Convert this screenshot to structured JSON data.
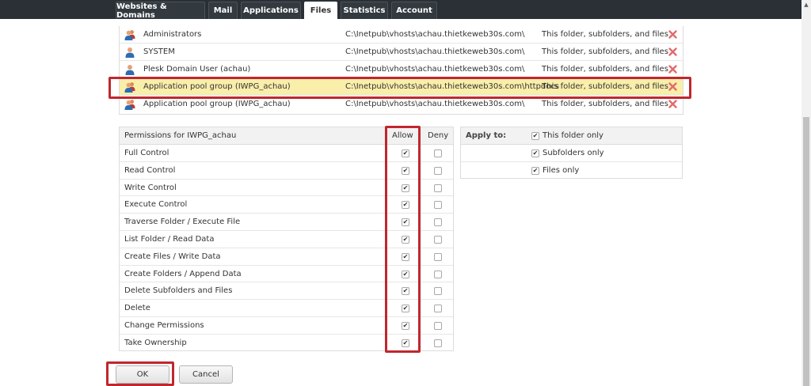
{
  "nav": {
    "tabs": [
      {
        "label": "Websites & Domains",
        "active": false
      },
      {
        "label": "Mail",
        "active": false
      },
      {
        "label": "Applications",
        "active": false
      },
      {
        "label": "Files",
        "active": true
      },
      {
        "label": "Statistics",
        "active": false
      },
      {
        "label": "Account",
        "active": false
      }
    ]
  },
  "users": [
    {
      "name": "Administrators",
      "path": "C:\\Inetpub\\vhosts\\achau.thietkeweb30s.com\\",
      "scope": "This folder, subfolders, and files",
      "icon": "user-group-icon",
      "selected": false
    },
    {
      "name": "SYSTEM",
      "path": "C:\\Inetpub\\vhosts\\achau.thietkeweb30s.com\\",
      "scope": "This folder, subfolders, and files",
      "icon": "user-icon",
      "selected": false
    },
    {
      "name": "Plesk Domain User (achau)",
      "path": "C:\\Inetpub\\vhosts\\achau.thietkeweb30s.com\\",
      "scope": "This folder, subfolders, and files",
      "icon": "user-icon",
      "selected": false
    },
    {
      "name": "Application pool group (IWPG_achau)",
      "path": "C:\\Inetpub\\vhosts\\achau.thietkeweb30s.com\\httpdocs",
      "scope": "This folder, subfolders, and files",
      "icon": "user-group-icon",
      "selected": true
    },
    {
      "name": "Application pool group (IWPG_achau)",
      "path": "C:\\Inetpub\\vhosts\\achau.thietkeweb30s.com\\",
      "scope": "This folder, subfolders, and files",
      "icon": "user-group-icon",
      "selected": false
    }
  ],
  "permissions": {
    "title": "Permissions for IWPG_achau",
    "allow_label": "Allow",
    "deny_label": "Deny",
    "rows": [
      {
        "label": "Full Control",
        "allow": true,
        "deny": false
      },
      {
        "label": "Read Control",
        "allow": true,
        "deny": false
      },
      {
        "label": "Write Control",
        "allow": true,
        "deny": false
      },
      {
        "label": "Execute Control",
        "allow": true,
        "deny": false
      },
      {
        "label": "Traverse Folder / Execute File",
        "allow": true,
        "deny": false
      },
      {
        "label": "List Folder / Read Data",
        "allow": true,
        "deny": false
      },
      {
        "label": "Create Files / Write Data",
        "allow": true,
        "deny": false
      },
      {
        "label": "Create Folders / Append Data",
        "allow": true,
        "deny": false
      },
      {
        "label": "Delete Subfolders and Files",
        "allow": true,
        "deny": false
      },
      {
        "label": "Delete",
        "allow": true,
        "deny": false
      },
      {
        "label": "Change Permissions",
        "allow": true,
        "deny": false
      },
      {
        "label": "Take Ownership",
        "allow": true,
        "deny": false
      }
    ]
  },
  "apply_to": {
    "label": "Apply to:",
    "options": [
      {
        "label": "This folder only",
        "checked": true
      },
      {
        "label": "Subfolders only",
        "checked": true
      },
      {
        "label": "Files only",
        "checked": true
      }
    ]
  },
  "buttons": {
    "ok": "OK",
    "cancel": "Cancel"
  },
  "colors": {
    "highlight": "#c0272d",
    "selected_row": "#f9eeaa",
    "nav_bg": "#2a3035"
  }
}
